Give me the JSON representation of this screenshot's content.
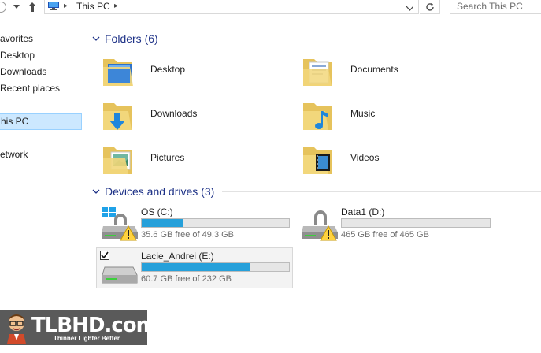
{
  "address_bar": {
    "path_root": "This PC",
    "search_placeholder": "Search This PC"
  },
  "nav_pane": {
    "items": [
      {
        "label": "avorites"
      },
      {
        "label": "Desktop"
      },
      {
        "label": "Downloads"
      },
      {
        "label": "Recent places"
      },
      {
        "label": "his PC"
      },
      {
        "label": "etwork"
      }
    ]
  },
  "folders_group": {
    "title": "Folders (6)",
    "items": [
      {
        "label": "Desktop",
        "icon": "desktop-folder-icon"
      },
      {
        "label": "Documents",
        "icon": "documents-folder-icon"
      },
      {
        "label": "Downloads",
        "icon": "downloads-folder-icon"
      },
      {
        "label": "Music",
        "icon": "music-folder-icon"
      },
      {
        "label": "Pictures",
        "icon": "pictures-folder-icon"
      },
      {
        "label": "Videos",
        "icon": "videos-folder-icon"
      }
    ]
  },
  "drives_group": {
    "title": "Devices and drives (3)",
    "items": [
      {
        "name": "OS (C:)",
        "free": "35.6 GB free of 49.3 GB",
        "used_fraction": 0.28,
        "warning": true,
        "windows_logo": true
      },
      {
        "name": "Data1 (D:)",
        "free": "465 GB free of 465 GB",
        "used_fraction": 0.0,
        "warning": true,
        "windows_logo": false
      },
      {
        "name": "Lacie_Andrei (E:)",
        "free": "60.7 GB free of 232 GB",
        "used_fraction": 0.74,
        "warning": false,
        "checked": true
      }
    ]
  },
  "colors": {
    "accent": "#26a0da",
    "group_title": "#1e3287",
    "selection": "#cce8ff"
  },
  "watermark": {
    "title": "TLBHD.com",
    "tagline": "Thinner Lighter Better"
  }
}
